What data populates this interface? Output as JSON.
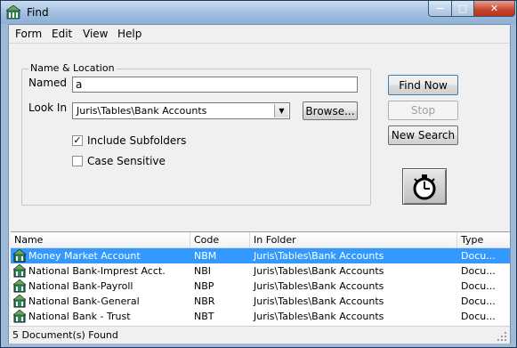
{
  "window": {
    "title": "Find",
    "controls": {
      "minimize": "—",
      "maximize": "□",
      "close": "✕"
    }
  },
  "menu": [
    "Form",
    "Edit",
    "View",
    "Help"
  ],
  "group": {
    "title": "Name & Location"
  },
  "named": {
    "label": "Named",
    "value": "a"
  },
  "look_in": {
    "label": "Look In",
    "value": "Juris\\Tables\\Bank Accounts"
  },
  "buttons": {
    "browse": "Browse...",
    "find_now": "Find Now",
    "stop": "Stop",
    "new_search": "New Search"
  },
  "options": {
    "include_subfolders": {
      "label": "Include Subfolders",
      "checked": true
    },
    "case_sensitive": {
      "label": "Case Sensitive",
      "checked": false
    }
  },
  "list": {
    "columns": [
      "Name",
      "Code",
      "In Folder",
      "Type"
    ],
    "rows": [
      {
        "name": "Money Market Account",
        "code": "NBM",
        "folder": "Juris\\Tables\\Bank Accounts",
        "type": "Docu...",
        "selected": true
      },
      {
        "name": "National Bank-Imprest Acct.",
        "code": "NBI",
        "folder": "Juris\\Tables\\Bank Accounts",
        "type": "Docu..."
      },
      {
        "name": "National Bank-Payroll",
        "code": "NBP",
        "folder": "Juris\\Tables\\Bank Accounts",
        "type": "Docu..."
      },
      {
        "name": "National Bank-General",
        "code": "NBR",
        "folder": "Juris\\Tables\\Bank Accounts",
        "type": "Docu..."
      },
      {
        "name": "National Bank - Trust",
        "code": "NBT",
        "folder": "Juris\\Tables\\Bank Accounts",
        "type": "Docu..."
      }
    ]
  },
  "status": {
    "text": "5 Document(s) Found"
  },
  "colors": {
    "selection": "#3399ff",
    "titlebar": "#9fbddf",
    "close_button": "#c7432a"
  }
}
